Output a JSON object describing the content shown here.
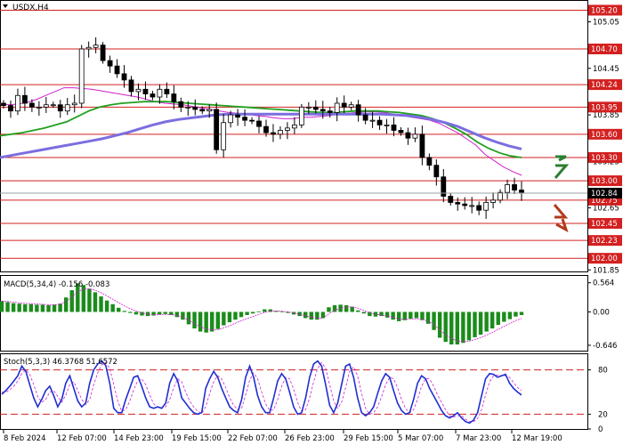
{
  "chart_data": {
    "type": "candlestick",
    "symbol_label": "USDX,H4",
    "price_axis": {
      "ylim": [
        101.83,
        105.32
      ],
      "ticks": [
        "105.05",
        "104.45",
        "103.85",
        "103.25",
        "102.65",
        "101.85"
      ],
      "tick_values": [
        105.05,
        104.45,
        103.85,
        103.25,
        102.65,
        101.85
      ]
    },
    "levels": [
      {
        "label": "105.20",
        "value": 105.2
      },
      {
        "label": "104.70",
        "value": 104.7
      },
      {
        "label": "104.24",
        "value": 104.24
      },
      {
        "label": "103.95",
        "value": 103.95
      },
      {
        "label": "103.60",
        "value": 103.6
      },
      {
        "label": "103.30",
        "value": 103.3
      },
      {
        "label": "103.00",
        "value": 103.0
      },
      {
        "label": "102.75",
        "value": 102.75
      },
      {
        "label": "102.45",
        "value": 102.45
      },
      {
        "label": "102.23",
        "value": 102.23
      },
      {
        "label": "102.00",
        "value": 102.0
      }
    ],
    "current_price": {
      "label": "102.84",
      "value": 102.84
    },
    "x_labels": [
      "8 Feb 2024",
      "12 Feb 07:00",
      "14 Feb 23:00",
      "19 Feb 15:00",
      "22 Feb 07:00",
      "26 Feb 23:00",
      "29 Feb 15:00",
      "5 Mar 07:00",
      "7 Mar 23:00",
      "12 Mar 19:00"
    ],
    "closes": [
      103.97,
      103.9,
      104.1,
      104.0,
      103.95,
      103.95,
      103.98,
      103.98,
      103.9,
      103.98,
      104.0,
      104.7,
      104.72,
      104.75,
      104.55,
      104.48,
      104.38,
      104.3,
      104.15,
      104.18,
      104.12,
      104.08,
      104.18,
      104.12,
      104.02,
      103.95,
      103.95,
      103.92,
      103.9,
      103.92,
      103.4,
      103.75,
      103.85,
      103.82,
      103.78,
      103.77,
      103.7,
      103.62,
      103.6,
      103.65,
      103.68,
      103.72,
      103.95,
      103.95,
      103.92,
      103.9,
      103.88,
      104.0,
      103.95,
      103.98,
      103.85,
      103.78,
      103.78,
      103.72,
      103.72,
      103.65,
      103.62,
      103.55,
      103.6,
      103.3,
      103.2,
      103.05,
      102.8,
      102.72,
      102.7,
      102.68,
      102.68,
      102.62,
      102.72,
      102.75,
      102.85,
      102.95,
      102.88,
      102.84
    ],
    "moving_averages": [
      {
        "color": "#d020d0",
        "values": [
          103.99,
          103.98,
          103.99,
          104.01,
          104.05,
          104.1,
          104.15,
          104.2,
          104.2,
          104.19,
          104.18,
          104.16,
          104.14,
          104.12,
          104.1,
          104.08,
          104.05,
          104.02,
          104.0,
          103.99,
          103.98,
          103.96,
          103.94,
          103.92,
          103.9,
          103.88,
          103.87,
          103.86,
          103.84,
          103.83,
          103.81,
          103.8,
          103.8,
          103.82,
          103.82,
          103.83,
          103.84,
          103.86,
          103.87,
          103.88,
          103.89,
          103.89,
          103.88,
          103.86,
          103.84,
          103.82,
          103.8,
          103.78,
          103.74,
          103.68,
          103.62,
          103.54,
          103.46,
          103.34,
          103.26,
          103.18,
          103.12,
          103.07
        ]
      },
      {
        "color": "#20a020",
        "values": [
          103.58,
          103.6,
          103.62,
          103.65,
          103.68,
          103.72,
          103.76,
          103.83,
          103.9,
          103.95,
          103.98,
          104.0,
          104.01,
          104.02,
          104.02,
          104.02,
          104.01,
          104.0,
          103.99,
          103.98,
          103.97,
          103.96,
          103.95,
          103.94,
          103.93,
          103.92,
          103.91,
          103.9,
          103.89,
          103.88,
          103.88,
          103.89,
          103.9,
          103.9,
          103.9,
          103.89,
          103.88,
          103.86,
          103.84,
          103.8,
          103.75,
          103.68,
          103.6,
          103.5,
          103.42,
          103.36,
          103.32,
          103.3
        ]
      },
      {
        "color": "#7b6ee0",
        "values": [
          103.3,
          103.33,
          103.36,
          103.39,
          103.42,
          103.45,
          103.48,
          103.51,
          103.54,
          103.58,
          103.62,
          103.67,
          103.72,
          103.76,
          103.79,
          103.81,
          103.83,
          103.85,
          103.86,
          103.86,
          103.86,
          103.86,
          103.86,
          103.86,
          103.86,
          103.86,
          103.86,
          103.86,
          103.86,
          103.86,
          103.86,
          103.85,
          103.84,
          103.82,
          103.79,
          103.75,
          103.7,
          103.63,
          103.56,
          103.5,
          103.45,
          103.41
        ]
      }
    ],
    "macd": {
      "label": "MACD(5,34,4) -0.156 -0.083",
      "ylim": [
        -0.75,
        0.68
      ],
      "ticks": [
        "0.564",
        "0.00",
        "-0.646"
      ],
      "tick_values": [
        0.564,
        0.0,
        -0.646
      ],
      "histogram": [
        0.21,
        0.19,
        0.17,
        0.16,
        0.15,
        0.15,
        0.14,
        0.14,
        0.13,
        0.14,
        0.16,
        0.28,
        0.42,
        0.55,
        0.52,
        0.45,
        0.38,
        0.3,
        0.22,
        0.15,
        0.08,
        0.02,
        -0.02,
        -0.05,
        -0.07,
        -0.08,
        -0.07,
        -0.05,
        -0.04,
        -0.06,
        -0.1,
        -0.15,
        -0.24,
        -0.32,
        -0.38,
        -0.4,
        -0.38,
        -0.33,
        -0.26,
        -0.2,
        -0.15,
        -0.1,
        -0.06,
        -0.03,
        0.01,
        0.05,
        0.05,
        0.02,
        0.01,
        -0.02,
        -0.05,
        -0.08,
        -0.12,
        -0.15,
        -0.15,
        -0.12,
        0.09,
        0.13,
        0.14,
        0.13,
        0.1,
        0.03,
        -0.03,
        -0.08,
        -0.09,
        -0.08,
        -0.11,
        -0.15,
        -0.18,
        -0.16,
        -0.13,
        -0.12,
        -0.16,
        -0.23,
        -0.35,
        -0.5,
        -0.58,
        -0.63,
        -0.63,
        -0.6,
        -0.55,
        -0.49,
        -0.44,
        -0.38,
        -0.32,
        -0.25,
        -0.19,
        -0.14,
        -0.09,
        -0.06
      ]
    },
    "stoch": {
      "label": "Stoch(5,3,3) 46.3768 51.6572",
      "ylim": [
        0,
        100
      ],
      "ticks": [
        "80",
        "20",
        "0"
      ],
      "tick_values": [
        80,
        20,
        0
      ],
      "levels": [
        80,
        20
      ],
      "main": [
        47,
        52,
        58,
        65,
        72,
        85,
        78,
        60,
        42,
        30,
        40,
        52,
        58,
        45,
        30,
        40,
        62,
        72,
        55,
        38,
        30,
        35,
        62,
        80,
        88,
        92,
        86,
        62,
        28,
        22,
        22,
        40,
        55,
        70,
        72,
        58,
        42,
        30,
        28,
        30,
        28,
        35,
        62,
        75,
        65,
        42,
        35,
        28,
        22,
        20,
        22,
        55,
        68,
        78,
        70,
        55,
        42,
        30,
        25,
        22,
        40,
        70,
        85,
        70,
        45,
        30,
        22,
        22,
        42,
        65,
        75,
        68,
        50,
        30,
        20,
        22,
        42,
        70,
        88,
        92,
        85,
        60,
        32,
        22,
        35,
        60,
        85,
        88,
        70,
        42,
        22,
        18,
        22,
        30,
        48,
        65,
        75,
        70,
        52,
        35,
        25,
        20,
        22,
        40,
        62,
        72,
        68,
        55,
        45,
        35,
        25,
        18,
        15,
        18,
        22,
        15,
        10,
        8,
        12,
        22,
        45,
        68,
        75,
        74,
        70,
        72,
        74,
        62,
        55,
        50,
        46
      ],
      "signal": [
        50,
        50,
        53,
        58,
        65,
        75,
        80,
        74,
        60,
        44,
        36,
        40,
        50,
        52,
        44,
        36,
        46,
        60,
        64,
        52,
        40,
        33,
        40,
        60,
        76,
        87,
        90,
        82,
        60,
        38,
        24,
        26,
        38,
        53,
        65,
        68,
        60,
        46,
        34,
        29,
        29,
        30,
        40,
        56,
        68,
        64,
        50,
        38,
        30,
        24,
        21,
        30,
        48,
        64,
        72,
        68,
        56,
        42,
        32,
        26,
        28,
        46,
        66,
        76,
        68,
        50,
        34,
        25,
        26,
        40,
        58,
        70,
        68,
        54,
        36,
        24,
        26,
        42,
        64,
        82,
        90,
        82,
        60,
        38,
        28,
        36,
        56,
        78,
        84,
        72,
        48,
        28,
        20,
        22,
        30,
        44,
        60,
        70,
        68,
        56,
        40,
        28,
        22,
        26,
        40,
        58,
        68,
        68,
        58,
        46,
        36,
        26,
        18,
        16,
        18,
        18,
        13,
        10,
        10,
        14,
        26,
        46,
        64,
        72,
        73,
        72,
        72,
        70,
        63,
        56,
        52
      ]
    }
  },
  "arrows": {
    "up_color": "#2e7d32",
    "down_color": "#b23a1c"
  }
}
